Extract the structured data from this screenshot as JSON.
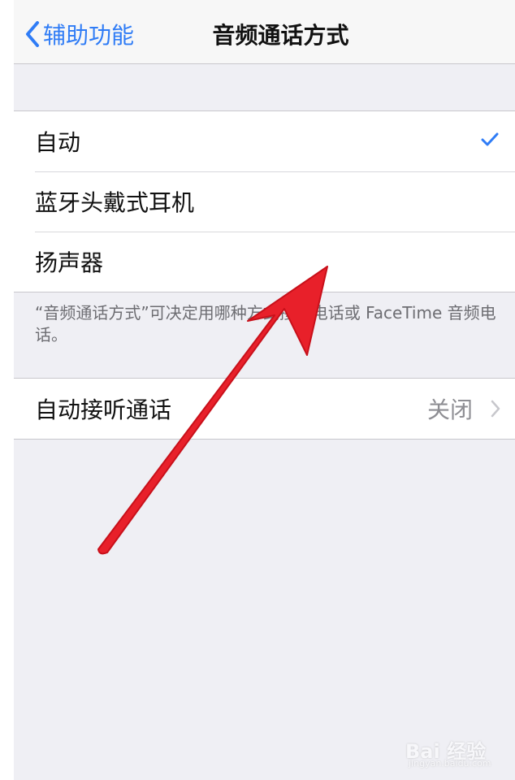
{
  "navbar": {
    "back_label": "辅助功能",
    "title": "音频通话方式"
  },
  "call_audio_routing": {
    "options": [
      {
        "label": "自动",
        "selected": true
      },
      {
        "label": "蓝牙头戴式耳机",
        "selected": false
      },
      {
        "label": "扬声器",
        "selected": false
      }
    ],
    "footer": "“音频通话方式”可决定用哪种方式接听电话或 FaceTime 音频电话。"
  },
  "auto_answer": {
    "label": "自动接听通话",
    "value": "关闭"
  },
  "colors": {
    "accent": "#2f7cf6",
    "background": "#efeff4",
    "arrow": "#e8202a"
  },
  "watermark": {
    "text": "Bai 经验",
    "sub": "jingyan.baidu.com"
  }
}
